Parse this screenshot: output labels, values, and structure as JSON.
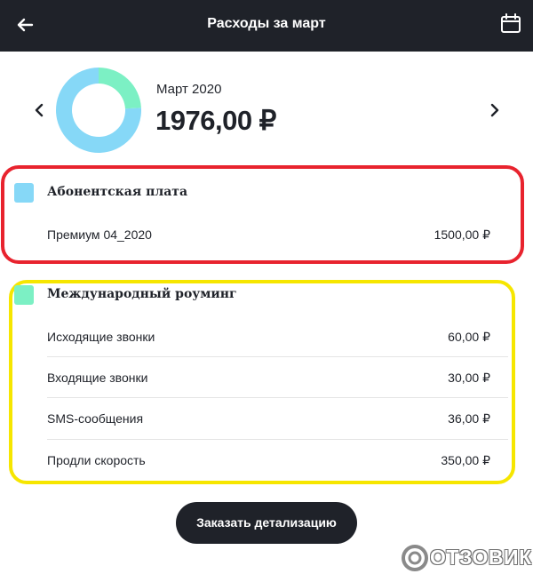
{
  "header": {
    "title": "Расходы за март",
    "back_icon": "arrow-left-icon",
    "calendar_icon": "calendar-icon"
  },
  "summary": {
    "month": "Март 2020",
    "total": "1976,00 ₽",
    "prev_icon": "chevron-left-icon",
    "next_icon": "chevron-right-icon",
    "chart_data": {
      "type": "pie",
      "categories": [
        "Абонентская плата",
        "Международный роуминг"
      ],
      "values": [
        1500,
        476
      ],
      "colors": [
        "#86d8f7",
        "#7cf0c4"
      ],
      "style": "donut"
    }
  },
  "groups": [
    {
      "title": "Абонентская плата",
      "color": "#86d8f7",
      "highlight": "#e8232e",
      "items": [
        {
          "label": "Премиум 04_2020",
          "value": "1500,00 ₽"
        }
      ]
    },
    {
      "title": "Международный роуминг",
      "color": "#7cf0c4",
      "highlight": "#f6e600",
      "items": [
        {
          "label": "Исходящие звонки",
          "value": "60,00 ₽"
        },
        {
          "label": "Входящие звонки",
          "value": "30,00 ₽"
        },
        {
          "label": "SMS-сообщения",
          "value": "36,00 ₽"
        },
        {
          "label": "Продли скорость",
          "value": "350,00 ₽"
        }
      ]
    }
  ],
  "cta": {
    "label": "Заказать детализацию"
  },
  "watermark": {
    "text": "ОТЗОВИК"
  }
}
